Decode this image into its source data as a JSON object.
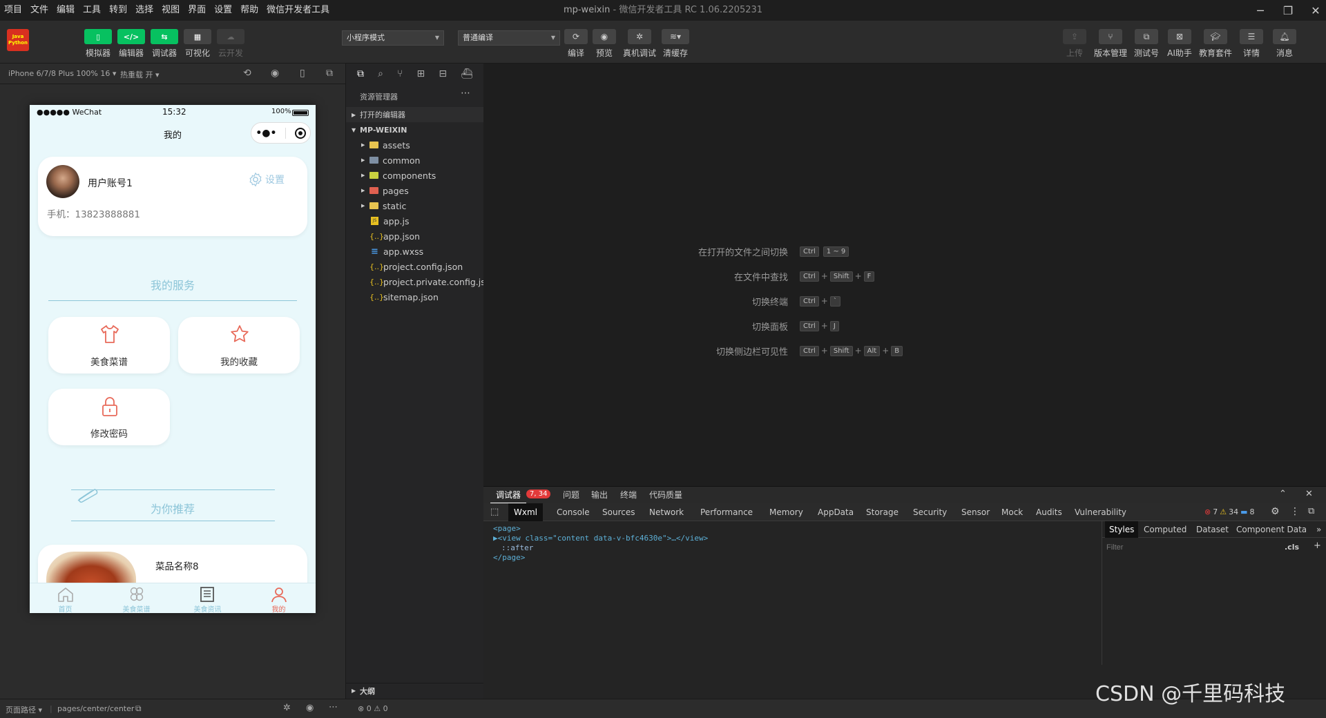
{
  "menubar": {
    "items": [
      "项目",
      "文件",
      "编辑",
      "工具",
      "转到",
      "选择",
      "视图",
      "界面",
      "设置",
      "帮助",
      "微信开发者工具"
    ]
  },
  "window": {
    "title": "mp-weixin",
    "subtitle": "微信开发者工具 RC 1.06.2205231",
    "logo_text": "Java Python"
  },
  "toolbar": {
    "left_buttons": [
      {
        "label": "模拟器",
        "icon": "phone-icon",
        "active": true
      },
      {
        "label": "编辑器",
        "icon": "code-icon",
        "active": true
      },
      {
        "label": "调试器",
        "icon": "debug-icon",
        "active": true
      },
      {
        "label": "可视化",
        "icon": "layout-icon",
        "active": false
      },
      {
        "label": "云开发",
        "icon": "cloud-icon",
        "disabled": true
      }
    ],
    "mode_select": "小程序模式",
    "compile_select": "普通编译",
    "mid_buttons": [
      {
        "label": "编译",
        "icon": "refresh-icon"
      },
      {
        "label": "预览",
        "icon": "eye-icon"
      },
      {
        "label": "真机调试",
        "icon": "bug-icon"
      },
      {
        "label": "清缓存",
        "icon": "layers-icon"
      }
    ],
    "right_buttons": [
      {
        "label": "上传",
        "icon": "upload-icon",
        "disabled": true
      },
      {
        "label": "版本管理",
        "icon": "branch-icon"
      },
      {
        "label": "测试号",
        "icon": "external-icon"
      },
      {
        "label": "AI助手",
        "icon": "ai-icon"
      },
      {
        "label": "教育套件",
        "icon": "graduation-icon"
      },
      {
        "label": "详情",
        "icon": "menu-icon"
      },
      {
        "label": "消息",
        "icon": "bell-icon"
      }
    ]
  },
  "simulator": {
    "device": "iPhone 6/7/8 Plus 100% 16 ▾",
    "hot_reload": "热重载 开 ▾",
    "status": {
      "carrier": "●●●●● WeChat",
      "time": "15:32",
      "battery": "100%"
    },
    "nav_title": "我的",
    "user": {
      "name": "用户账号1",
      "settings": "设置",
      "phone": "手机：13823888881"
    },
    "services_title": "我的服务",
    "services": [
      {
        "label": "美食菜谱",
        "icon": "shirt-icon"
      },
      {
        "label": "我的收藏",
        "icon": "star-icon"
      },
      {
        "label": "修改密码",
        "icon": "lock-icon"
      }
    ],
    "recommend_title": "为你推荐",
    "recommend_item": "菜品名称8",
    "tabbar": [
      {
        "label": "首页",
        "icon": "home-icon"
      },
      {
        "label": "美食菜谱",
        "icon": "flower-icon"
      },
      {
        "label": "美食资讯",
        "icon": "news-icon"
      },
      {
        "label": "我的",
        "icon": "user-icon"
      }
    ]
  },
  "footer": {
    "page_path_label": "页面路径 ▾",
    "page_path": "pages/center/center"
  },
  "explorer": {
    "title": "资源管理器",
    "open_editors": "打开的编辑器",
    "project": "MP-WEIXIN",
    "outline": "大纲",
    "status": "⊗ 0 ⚠ 0",
    "files": [
      {
        "name": "assets",
        "type": "folder",
        "color": "#e8c450"
      },
      {
        "name": "common",
        "type": "folder",
        "color": "#7e8fa3"
      },
      {
        "name": "components",
        "type": "folder",
        "color": "#c8d040"
      },
      {
        "name": "pages",
        "type": "folder",
        "color": "#e06050"
      },
      {
        "name": "static",
        "type": "folder",
        "color": "#e8c450"
      },
      {
        "name": "app.js",
        "type": "js"
      },
      {
        "name": "app.json",
        "type": "json"
      },
      {
        "name": "app.wxss",
        "type": "css"
      },
      {
        "name": "project.config.json",
        "type": "json"
      },
      {
        "name": "project.private.config.js...",
        "type": "json"
      },
      {
        "name": "sitemap.json",
        "type": "json"
      }
    ]
  },
  "shortcuts": [
    {
      "label": "在打开的文件之间切换",
      "keys": [
        "Ctrl",
        "1 ~ 9"
      ]
    },
    {
      "label": "在文件中查找",
      "keys": [
        "Ctrl",
        "Shift",
        "F"
      ]
    },
    {
      "label": "切换终端",
      "keys": [
        "Ctrl",
        "`"
      ]
    },
    {
      "label": "切换面板",
      "keys": [
        "Ctrl",
        "J"
      ]
    },
    {
      "label": "切换侧边栏可见性",
      "keys": [
        "Ctrl",
        "Shift",
        "Alt",
        "B"
      ]
    }
  ],
  "devtools": {
    "top_tabs": [
      "调试器",
      "问题",
      "输出",
      "终端",
      "代码质量"
    ],
    "badge": "7, 34",
    "panels": [
      "Wxml",
      "Console",
      "Sources",
      "Network",
      "Performance",
      "Memory",
      "AppData",
      "Storage",
      "Security",
      "Sensor",
      "Mock",
      "Audits",
      "Vulnerability"
    ],
    "counts": {
      "errors": "7",
      "warnings": "34",
      "info": "8"
    },
    "wxml_lines": [
      "<page>",
      "▶<view class=\"content data-v-bfc4630e\">…</view>",
      "::after",
      "</page>"
    ],
    "style_tabs": [
      "Styles",
      "Computed",
      "Dataset",
      "Component Data"
    ],
    "filter_placeholder": "Filter",
    "cls": ".cls"
  },
  "watermark": "CSDN @千里码科技"
}
